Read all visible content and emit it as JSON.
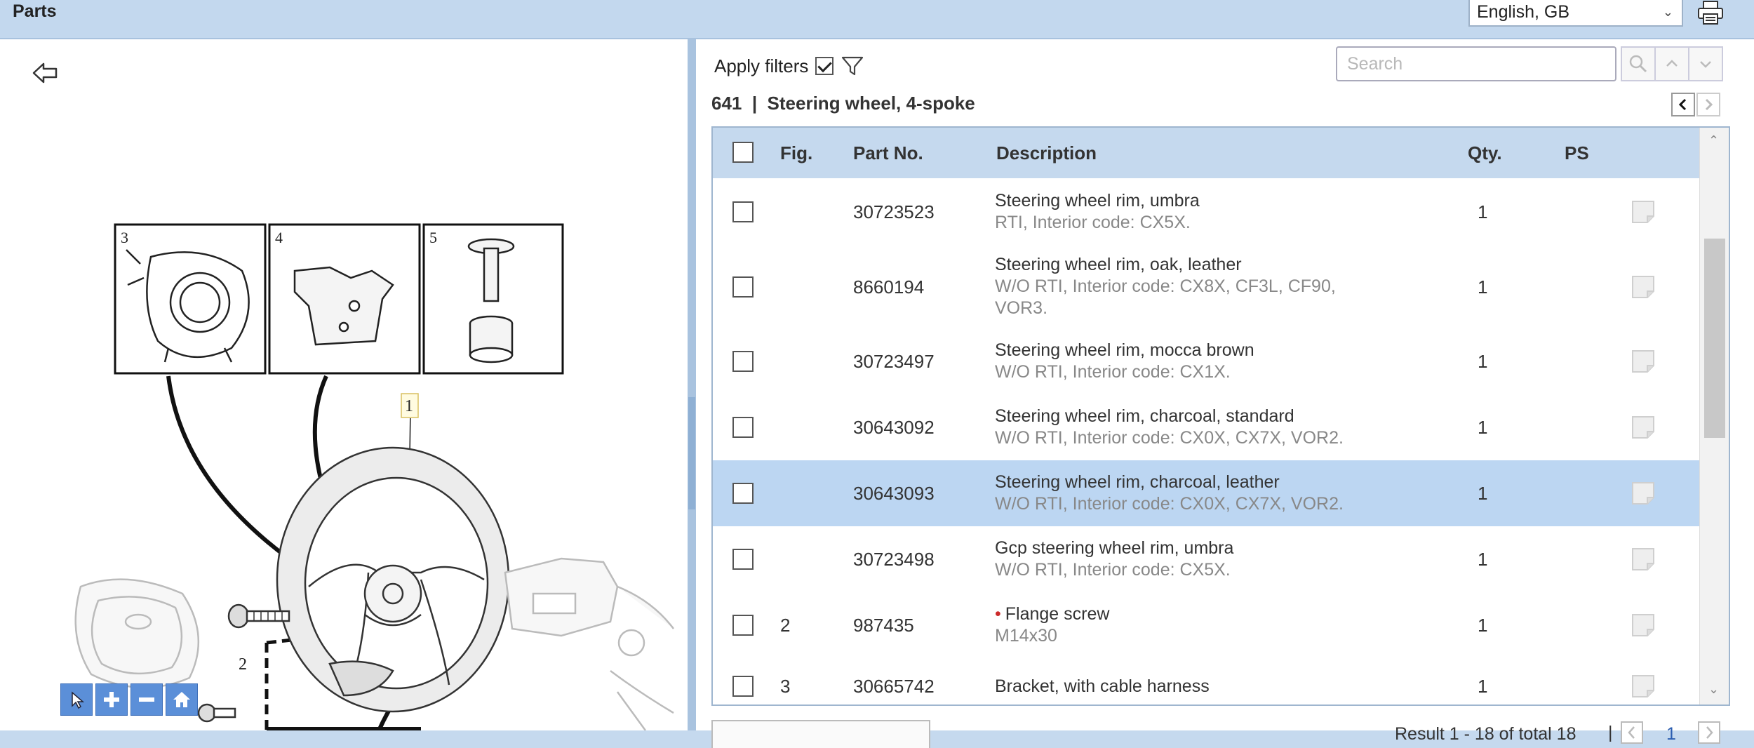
{
  "header": {
    "title": "Parts",
    "language": "English, GB"
  },
  "diagram": {
    "callouts": [
      "3",
      "4",
      "5",
      "1",
      "2"
    ]
  },
  "filters": {
    "apply_label": "Apply filters",
    "apply_checked": true
  },
  "search": {
    "placeholder": "Search"
  },
  "section": {
    "heading": "641  |  Steering wheel, 4-spoke"
  },
  "grid": {
    "columns": {
      "fig": "Fig.",
      "part_no": "Part No.",
      "description": "Description",
      "qty": "Qty.",
      "ps": "PS"
    },
    "rows": [
      {
        "fig": "",
        "part_no": "30723523",
        "desc": "Steering wheel rim, umbra",
        "sub": "RTI, Interior code: CX5X.",
        "qty": "1",
        "bullet": false,
        "selected": false
      },
      {
        "fig": "",
        "part_no": "8660194",
        "desc": "Steering wheel rim, oak, leather",
        "sub": "W/O RTI, Interior code: CX8X, CF3L, CF90, VOR3.",
        "qty": "1",
        "bullet": false,
        "selected": false
      },
      {
        "fig": "",
        "part_no": "30723497",
        "desc": "Steering wheel rim, mocca brown",
        "sub": "W/O RTI, Interior code: CX1X.",
        "qty": "1",
        "bullet": false,
        "selected": false
      },
      {
        "fig": "",
        "part_no": "30643092",
        "desc": "Steering wheel rim, charcoal, standard",
        "sub": "W/O RTI, Interior code: CX0X, CX7X, VOR2.",
        "qty": "1",
        "bullet": false,
        "selected": false
      },
      {
        "fig": "",
        "part_no": "30643093",
        "desc": "Steering wheel rim, charcoal, leather",
        "sub": "W/O RTI, Interior code: CX0X, CX7X, VOR2.",
        "qty": "1",
        "bullet": false,
        "selected": true
      },
      {
        "fig": "",
        "part_no": "30723498",
        "desc": "Gcp steering wheel rim, umbra",
        "sub": "W/O RTI, Interior code: CX5X.",
        "qty": "1",
        "bullet": false,
        "selected": false
      },
      {
        "fig": "2",
        "part_no": "987435",
        "desc": "Flange screw",
        "sub": "M14x30",
        "qty": "1",
        "bullet": true,
        "selected": false
      },
      {
        "fig": "3",
        "part_no": "30665742",
        "desc": "Bracket, with cable harness",
        "sub": "",
        "qty": "1",
        "bullet": false,
        "selected": false
      }
    ]
  },
  "footer": {
    "result": "Result 1 - 18 of total 18",
    "page": "1"
  },
  "colors": {
    "header_bg": "#c3d8ee",
    "selected_row": "#bcd6f2",
    "zoom_button": "#5b8fd8"
  }
}
